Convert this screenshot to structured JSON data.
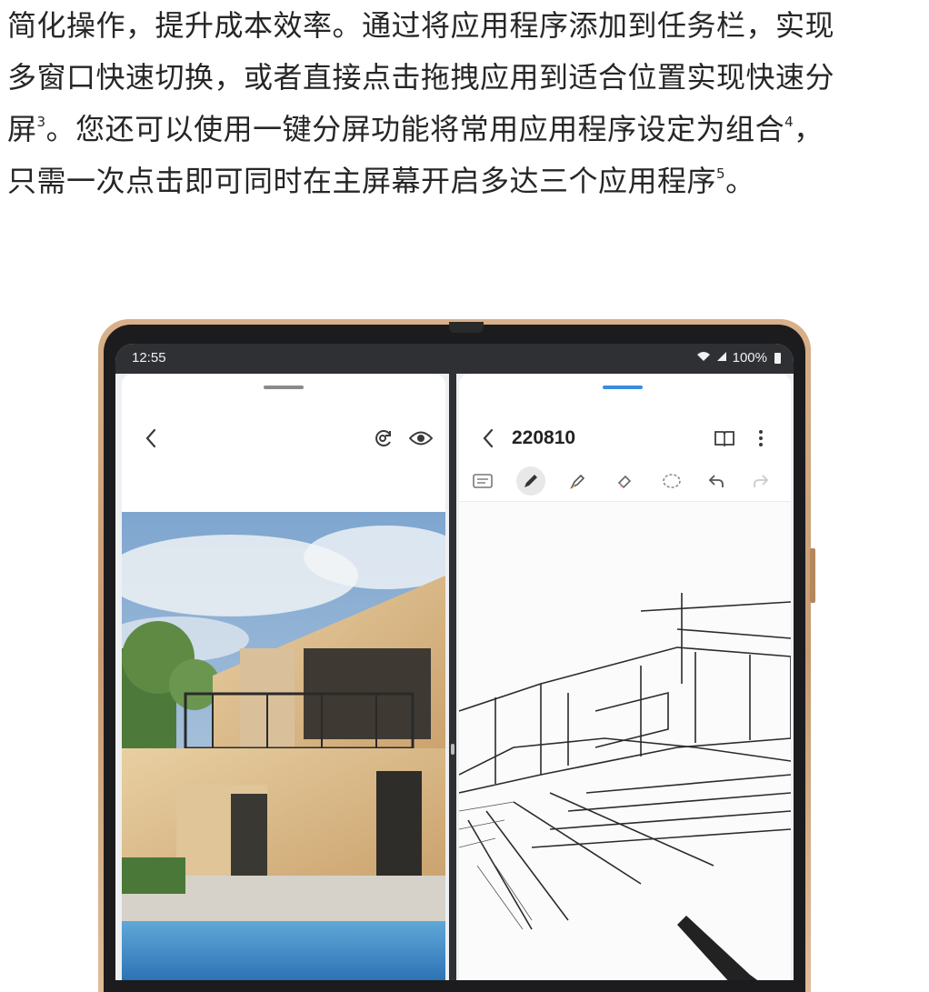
{
  "article": {
    "line1": "简化操作，提升成本效率。通过将应用程序添加到任务栏，实现",
    "line2": "多窗口快速切换，或者直接点击拖拽应用到适合位置实现快速分",
    "line3_a": "屏",
    "line3_sup1": "3",
    "line3_b": "。您还可以使用一键分屏功能将常用应用程序设定为组合",
    "line3_sup2": "4",
    "line3_c": "，",
    "line4_a": "只需一次点击即可同时在主屏幕开启多达三个应用程序",
    "line4_sup": "5",
    "line4_b": "。"
  },
  "device": {
    "status_time": "12:55",
    "battery": "100%",
    "left_app": {
      "back_icon": "chevron-left-icon",
      "ar_icon": "ar-rotate-icon",
      "eye_icon": "eye-icon"
    },
    "right_app": {
      "title": "220810",
      "back_icon": "chevron-left-icon",
      "book_icon": "book-open-icon",
      "more_icon": "more-vertical-icon",
      "tools": [
        "keyboard-icon",
        "pen-icon",
        "highlighter-icon",
        "eraser-icon",
        "lasso-icon",
        "undo-icon",
        "redo-icon"
      ],
      "active_tool": "pen-icon"
    }
  },
  "colors": {
    "accent": "#3a8de0",
    "frame": "#c69b72",
    "status_bar": "#2e3033"
  }
}
